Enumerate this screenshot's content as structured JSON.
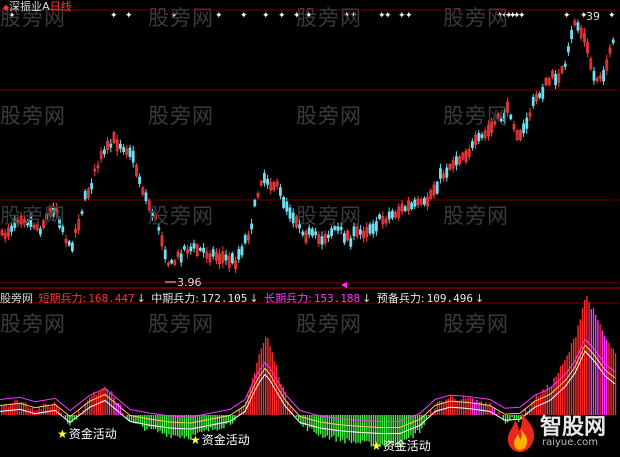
{
  "header": {
    "name_marker": "◆",
    "name": "深振业A",
    "period": "日线"
  },
  "price_panel": {
    "low_label": "3.96",
    "high_label": "39",
    "marker_glyph": "✦"
  },
  "indicator": {
    "name": "股旁网",
    "items": [
      {
        "label": "短期兵力:",
        "value": "168.447",
        "arrow": "↓",
        "color": "#ff3333"
      },
      {
        "label": "中期兵力:",
        "value": "172.105",
        "arrow": "↓",
        "color": "#e6e6e6"
      },
      {
        "label": "长期兵力:",
        "value": "153.188",
        "arrow": "↓",
        "color": "#ff33ff"
      },
      {
        "label": "预备兵力:",
        "value": "109.496",
        "arrow": "↓",
        "color": "#e6e6e6"
      }
    ]
  },
  "annotations": [
    {
      "star": "★",
      "text": "资金活动"
    },
    {
      "star": "★",
      "text": "资金活动"
    },
    {
      "star": "★",
      "text": "资金活动"
    }
  ],
  "watermark": "股旁网",
  "logo": {
    "title": "智股网",
    "url": "raiyue.com"
  },
  "colors": {
    "up": "#ff3b3b",
    "down": "#6fe0ef",
    "grid": "#8b0000",
    "ind_red": "#ff2b2b",
    "ind_green": "#44ee44",
    "ind_magenta": "#ff33ff"
  }
}
